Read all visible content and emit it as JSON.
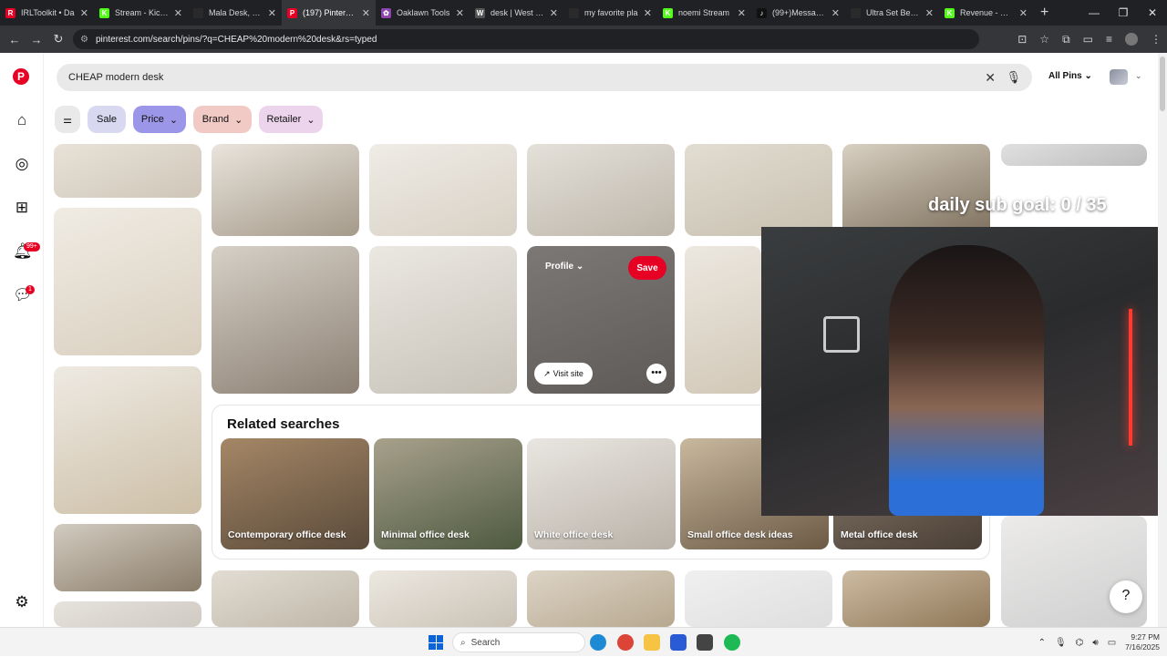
{
  "browser": {
    "tabs": [
      {
        "title": "IRLToolkit • Da",
        "color": "#e60023",
        "glyph": "R"
      },
      {
        "title": "Stream - Kick D",
        "color": "#53fc18",
        "glyph": "K"
      },
      {
        "title": "Mala Desk, Nat",
        "color": "#2a2a2a",
        "glyph": ""
      },
      {
        "title": "(197) Pinterest",
        "color": "#e60023",
        "glyph": "P",
        "active": true
      },
      {
        "title": "Oaklawn Tools",
        "color": "#8e44ad",
        "glyph": "✿"
      },
      {
        "title": "desk | West Elm",
        "color": "#555555",
        "glyph": "W"
      },
      {
        "title": "my favorite pla",
        "color": "#2a2a2a",
        "glyph": ""
      },
      {
        "title": "noemi Stream",
        "color": "#53fc18",
        "glyph": "K"
      },
      {
        "title": "(99+)Messages",
        "color": "#111111",
        "glyph": "♪"
      },
      {
        "title": "Ultra Set Bed F",
        "color": "#2a2a2a",
        "glyph": ""
      },
      {
        "title": "Revenue - Kick",
        "color": "#53fc18",
        "glyph": "K"
      }
    ],
    "new_tab": "+",
    "url": "pinterest.com/search/pins/?q=CHEAP%20modern%20desk&rs=typed",
    "window_controls": [
      "—",
      "❐",
      "✕"
    ]
  },
  "rail": {
    "logo": "P",
    "notifications_badge": "99+",
    "messages_badge": "1"
  },
  "search": {
    "query": "CHEAP modern desk",
    "scope": "All Pins"
  },
  "filters": {
    "sale": "Sale",
    "price": "Price",
    "brand": "Brand",
    "retailer": "Retailer"
  },
  "hover_pin": {
    "profile": "Profile",
    "save": "Save",
    "visit": "Visit site",
    "more": "•••"
  },
  "related": {
    "heading": "Related searches",
    "items": [
      "Contemporary office desk",
      "Minimal office desk",
      "White office desk",
      "Small office desk ideas",
      "Metal office desk"
    ]
  },
  "overlay": {
    "goal_text": "daily sub goal: 0 / 35"
  },
  "help": "?",
  "taskbar": {
    "search_label": "Search",
    "time": "9:27 PM",
    "date": "7/16/2025"
  },
  "colors": {
    "pinterest_red": "#e60023",
    "price_chip": "#9b96e8",
    "brand_chip": "#f1c9c5",
    "retailer_chip": "#ecd5ec",
    "sale_chip": "#d8d8f0"
  }
}
